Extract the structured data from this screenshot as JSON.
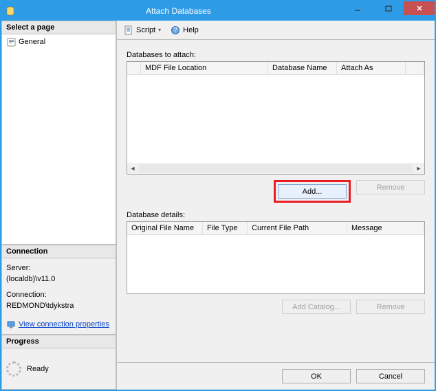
{
  "window": {
    "title": "Attach Databases"
  },
  "sidebar": {
    "select_page_label": "Select a page",
    "pages": [
      {
        "label": "General"
      }
    ],
    "connection_header": "Connection",
    "server_label": "Server:",
    "server_value": "(localdb)\\v11.0",
    "connection_label": "Connection:",
    "connection_value": "REDMOND\\tdykstra",
    "view_props_link": "View connection properties",
    "progress_header": "Progress",
    "progress_status": "Ready"
  },
  "toolbar": {
    "script_label": "Script",
    "help_label": "Help"
  },
  "main": {
    "databases_to_attach_label": "Databases to attach:",
    "attach_columns": {
      "mdf": "MDF File Location",
      "dbname": "Database Name",
      "attachas": "Attach As"
    },
    "add_btn": "Add...",
    "remove_btn": "Remove",
    "database_details_label": "Database details:",
    "detail_columns": {
      "ofn": "Original File Name",
      "ft": "File Type",
      "cfp": "Current File Path",
      "msg": "Message"
    },
    "add_catalog_btn": "Add Catalog...",
    "remove2_btn": "Remove"
  },
  "footer": {
    "ok": "OK",
    "cancel": "Cancel"
  }
}
